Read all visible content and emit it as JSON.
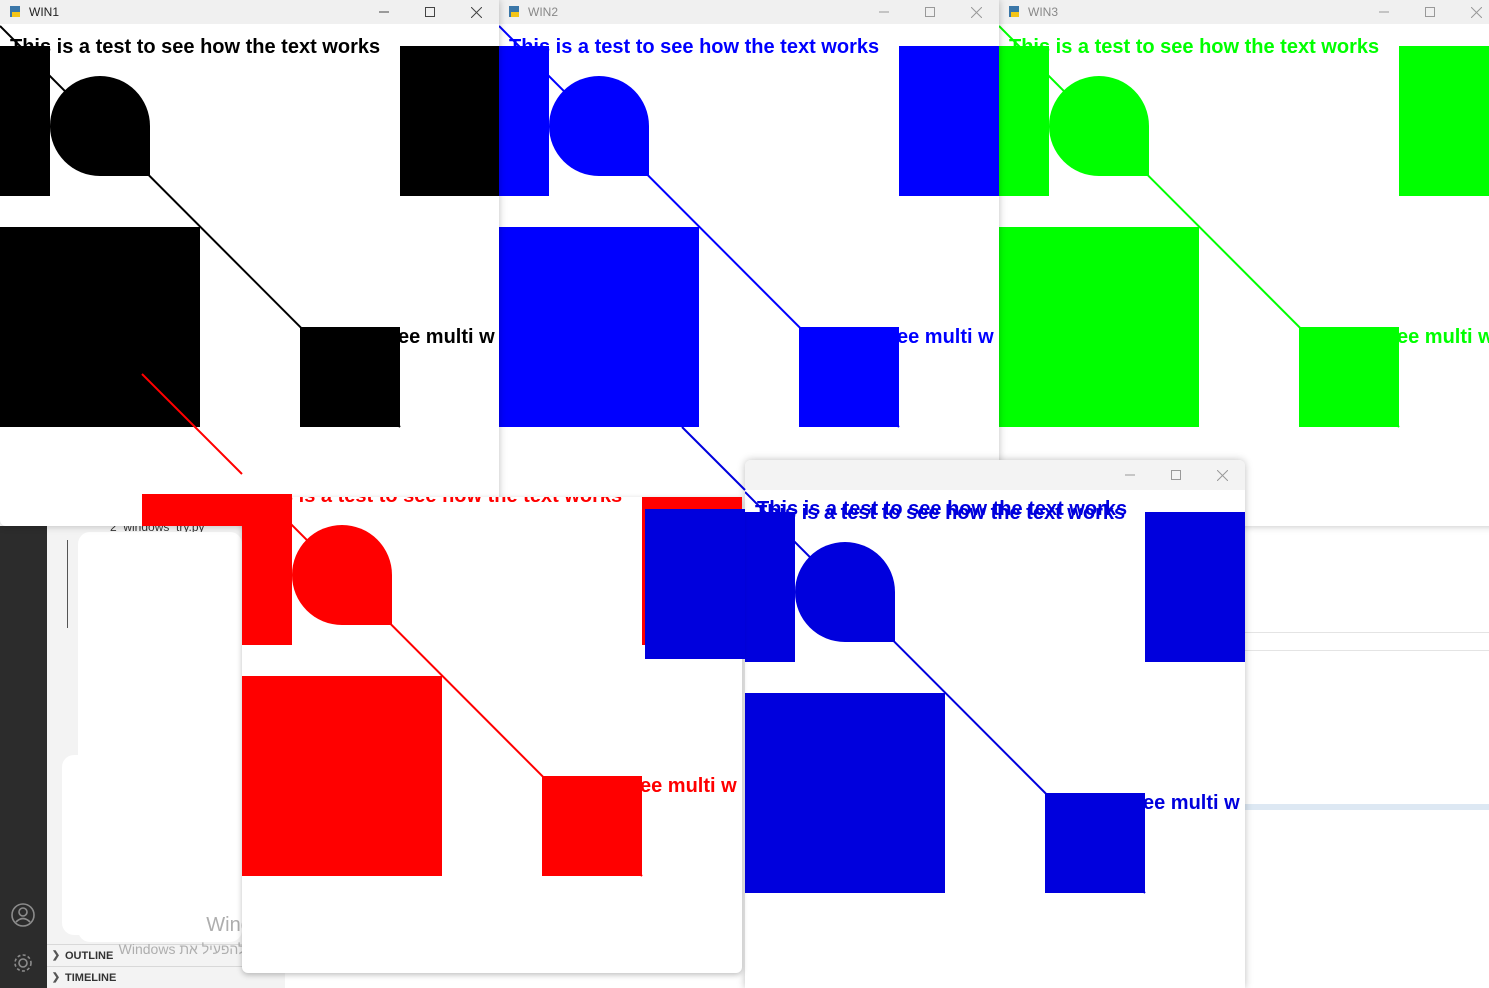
{
  "windows": {
    "win1": {
      "title": "WIN1",
      "color": "#000000"
    },
    "win2": {
      "title": "WIN2",
      "color": "#0000ff"
    },
    "win3": {
      "title": "WIN3",
      "color": "#00ff00"
    },
    "win4": {
      "title": "",
      "color": "#ff0000"
    },
    "win5": {
      "title": "",
      "color": "#0000dd"
    }
  },
  "canvas_text": {
    "main": "This is a test to see how the text works",
    "secondary": "ee multi w"
  },
  "vscode": {
    "file_name": "2_windows_try.py",
    "sections": [
      "OUTLINE",
      "TIMELINE"
    ],
    "activation_line1": "הפעל את Windows",
    "activation_line2": "עבור אל 'הגדרות' כדי להפעיל את Windows"
  },
  "icons": {
    "window_logo": "python-icon",
    "minimize": "minimize-icon",
    "maximize": "maximize-icon",
    "close": "close-icon",
    "account": "account-icon",
    "settings": "gear-icon"
  }
}
